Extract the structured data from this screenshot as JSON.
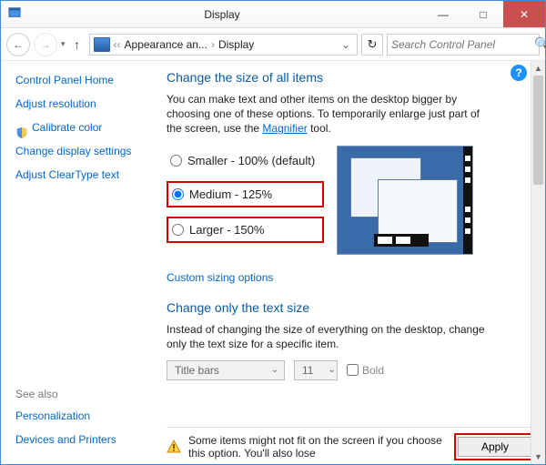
{
  "window": {
    "title": "Display"
  },
  "breadcrumb": {
    "item1": "Appearance an...",
    "item2": "Display"
  },
  "search": {
    "placeholder": "Search Control Panel"
  },
  "sidebar": {
    "home": "Control Panel Home",
    "links": {
      "adjust_resolution": "Adjust resolution",
      "calibrate_color": "Calibrate color",
      "change_display_settings": "Change display settings",
      "adjust_cleartype": "Adjust ClearType text"
    },
    "see_also_head": "See also",
    "see_also": {
      "personalization": "Personalization",
      "devices_printers": "Devices and Printers"
    }
  },
  "main": {
    "heading1": "Change the size of all items",
    "desc1_a": "You can make text and other items on the desktop bigger by choosing one of these options. To temporarily enlarge just part of the screen, use the ",
    "desc1_link": "Magnifier",
    "desc1_b": " tool.",
    "radio_smaller": "Smaller - 100% (default)",
    "radio_medium": "Medium - 125%",
    "radio_larger": "Larger - 150%",
    "custom_link": "Custom sizing options",
    "heading2": "Change only the text size",
    "desc2": "Instead of changing the size of everything on the desktop, change only the text size for a specific item.",
    "select_item": "Title bars",
    "select_size": "11",
    "bold_label": "Bold",
    "notice": "Some items might not fit on the screen if you choose this option. You'll also lose",
    "apply_label": "Apply"
  }
}
